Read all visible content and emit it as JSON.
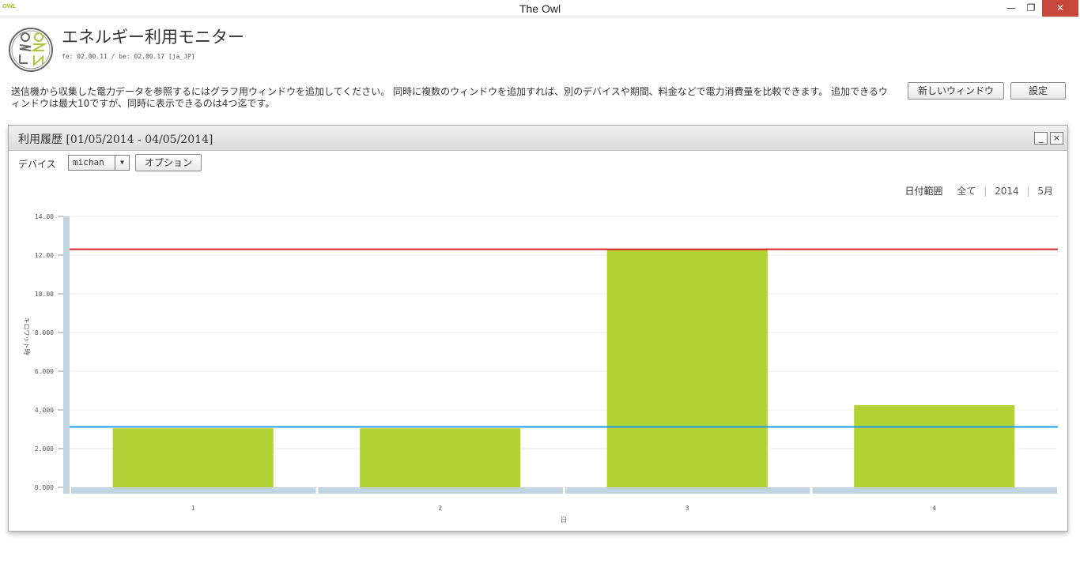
{
  "window": {
    "title": "The Owl",
    "mini_logo": "OWL"
  },
  "header": {
    "title": "エネルギー利用モニター",
    "version": "fe: 02.00.11 / be: 02.00.17 [ja_JP]"
  },
  "intro_text": "送信機から収集した電力データを参照するにはグラフ用ウィンドウを追加してください。 同時に複数のウィンドウを追加すれば、別のデバイスや期間、料金などで電力消費量を比較できます。 追加できるウィンドウは最大10ですが、同時に表示できるのは4つ迄です。",
  "buttons": {
    "new_window": "新しいウィンドウ",
    "settings": "設定"
  },
  "panel": {
    "title": "利用履歴 [01/05/2014 - 04/05/2014]",
    "minimize": "_",
    "close": "×",
    "device_label": "デバイス",
    "device_value": "michan",
    "options_label": "オプション",
    "date_range": {
      "label": "日付範囲",
      "all": "全て",
      "year": "2014",
      "month": "5月"
    }
  },
  "colors": {
    "bar": "#b3d235",
    "max_line": "#d9232a",
    "avg_line": "#1e9be8",
    "axis": "#c3d3e0",
    "grid": "#ececec"
  },
  "chart_data": {
    "type": "bar",
    "categories": [
      "1",
      "2",
      "3",
      "4"
    ],
    "values": [
      3.05,
      3.05,
      12.3,
      4.25
    ],
    "ylim": [
      0,
      14
    ],
    "yticks": [
      "0.000",
      "2.000",
      "4.000",
      "6.000",
      "8.000",
      "10.00",
      "12.00",
      "14.00"
    ],
    "ytick_values": [
      0,
      2,
      4,
      6,
      8,
      10,
      12,
      14
    ],
    "xlabel": "日",
    "ylabel": "キロワット時",
    "reference_lines": [
      12.3,
      3.12
    ],
    "grid": true
  }
}
